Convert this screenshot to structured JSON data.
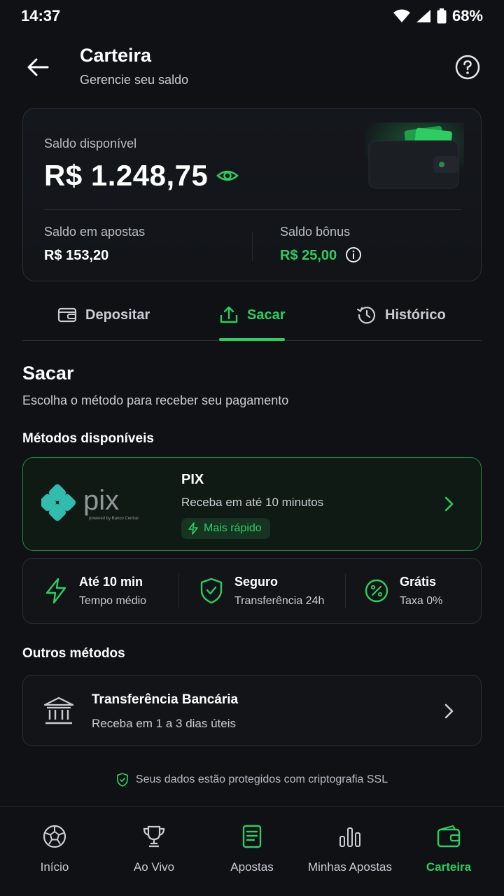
{
  "status": {
    "time": "14:37",
    "battery": "68%"
  },
  "header": {
    "title": "Carteira",
    "subtitle": "Gerencie seu saldo"
  },
  "balance": {
    "label": "Saldo disponível",
    "value": "R$ 1.248,75",
    "bets_label": "Saldo em apostas",
    "bets_value": "R$ 153,20",
    "bonus_label": "Saldo bônus",
    "bonus_value": "R$ 25,00"
  },
  "tabs": [
    {
      "label": "Depositar",
      "icon": "wallet-icon"
    },
    {
      "label": "Sacar",
      "icon": "upload-icon",
      "active": true
    },
    {
      "label": "Histórico",
      "icon": "history-icon"
    }
  ],
  "section": {
    "title": "Sacar",
    "subtitle": "Escolha o método para receber seu pagamento"
  },
  "methods_label": "Métodos disponíveis",
  "pix": {
    "name": "PIX",
    "description": "Receba em até 10 minutos",
    "badge": "Mais rápido",
    "logo_text": "pix",
    "logo_caption": "powered by Banco Central"
  },
  "features": [
    {
      "title": "Até 10 min",
      "subtitle": "Tempo médio",
      "icon": "bolt-icon"
    },
    {
      "title": "Seguro",
      "subtitle": "Transferência 24h",
      "icon": "shield-check-icon"
    },
    {
      "title": "Grátis",
      "subtitle": "Taxa 0%",
      "icon": "percent-icon"
    }
  ],
  "other_label": "Outros métodos",
  "bank": {
    "title": "Transferência Bancária",
    "description": "Receba em 1 a 3 dias úteis",
    "icon": "bank-icon"
  },
  "ssl_text": "Seus dados estão protegidos com criptografia SSL",
  "nav": [
    {
      "label": "Início",
      "icon": "soccer-ball-icon"
    },
    {
      "label": "Ao Vivo",
      "icon": "trophy-icon"
    },
    {
      "label": "Apostas",
      "icon": "ticket-icon"
    },
    {
      "label": "Minhas Apostas",
      "icon": "bar-chart-icon"
    },
    {
      "label": "Carteira",
      "icon": "wallet-icon",
      "active": true
    }
  ],
  "colors": {
    "accent": "#2ecc62",
    "background": "#0f1115",
    "card": "#121418"
  }
}
